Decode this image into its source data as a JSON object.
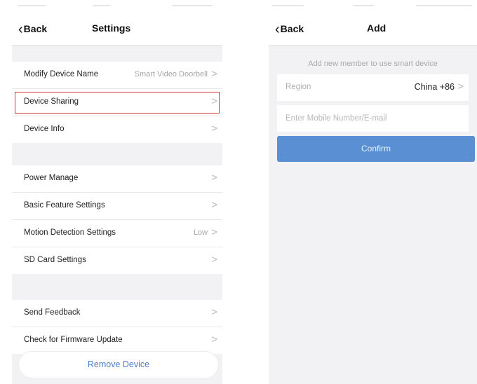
{
  "settings": {
    "back_label": "Back",
    "title": "Settings",
    "groups": [
      [
        {
          "label": "Modify Device Name",
          "value": "Smart Video Doorbell"
        },
        {
          "label": "Device Sharing",
          "value": ""
        },
        {
          "label": "Device Info",
          "value": ""
        }
      ],
      [
        {
          "label": "Power Manage",
          "value": ""
        },
        {
          "label": "Basic Feature Settings",
          "value": ""
        },
        {
          "label": "Motion Detection Settings",
          "value": "Low"
        },
        {
          "label": "SD Card Settings",
          "value": ""
        }
      ],
      [
        {
          "label": "Send Feedback",
          "value": ""
        },
        {
          "label": "Check for Firmware Update",
          "value": ""
        }
      ]
    ],
    "remove_label": "Remove Device",
    "arrow": ">"
  },
  "add": {
    "back_label": "Back",
    "title": "Add",
    "hint": "Add new member to use smart device",
    "region_label": "Region",
    "region_value": "China +86",
    "contact_placeholder": "Enter Mobile Number/E-mail",
    "confirm_label": "Confirm"
  },
  "colors": {
    "highlight": "#d43a3a",
    "accent": "#5a8fd3",
    "link": "#4a7fc9"
  },
  "icons": {
    "back": "chevron-left-icon",
    "row": "chevron-right-icon"
  }
}
